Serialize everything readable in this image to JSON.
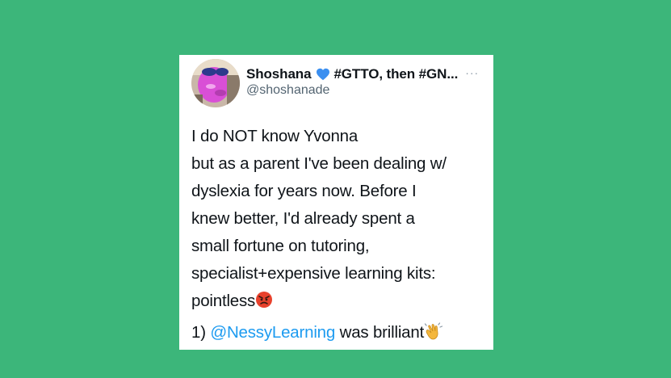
{
  "tweet": {
    "author": {
      "display_name_part1": "Shoshana",
      "display_name_part2": "#GTTO, then #GN...",
      "heart_icon": "blue-heart-icon",
      "handle": "@shoshanade",
      "more_icon": "···"
    },
    "body_lines": [
      "I do NOT know Yvonna",
      "but as a parent I've been dealing w/",
      "dyslexia for years now. Before I",
      "knew better, I'd already spent a",
      "small fortune on tutoring,",
      "specialist+expensive learning kits:",
      "pointless"
    ],
    "angry_emoji": "angry-face-emoji",
    "thread": {
      "prefix": "1) ",
      "mention": "@NessyLearning",
      "suffix": " was brilliant",
      "clap_emoji": "clapping-hands-emoji"
    }
  },
  "colors": {
    "background": "#3cb67a",
    "card": "#ffffff",
    "text": "#0f1419",
    "secondary": "#536471",
    "link": "#1d9bf0",
    "heart": "#3b8ff0"
  }
}
